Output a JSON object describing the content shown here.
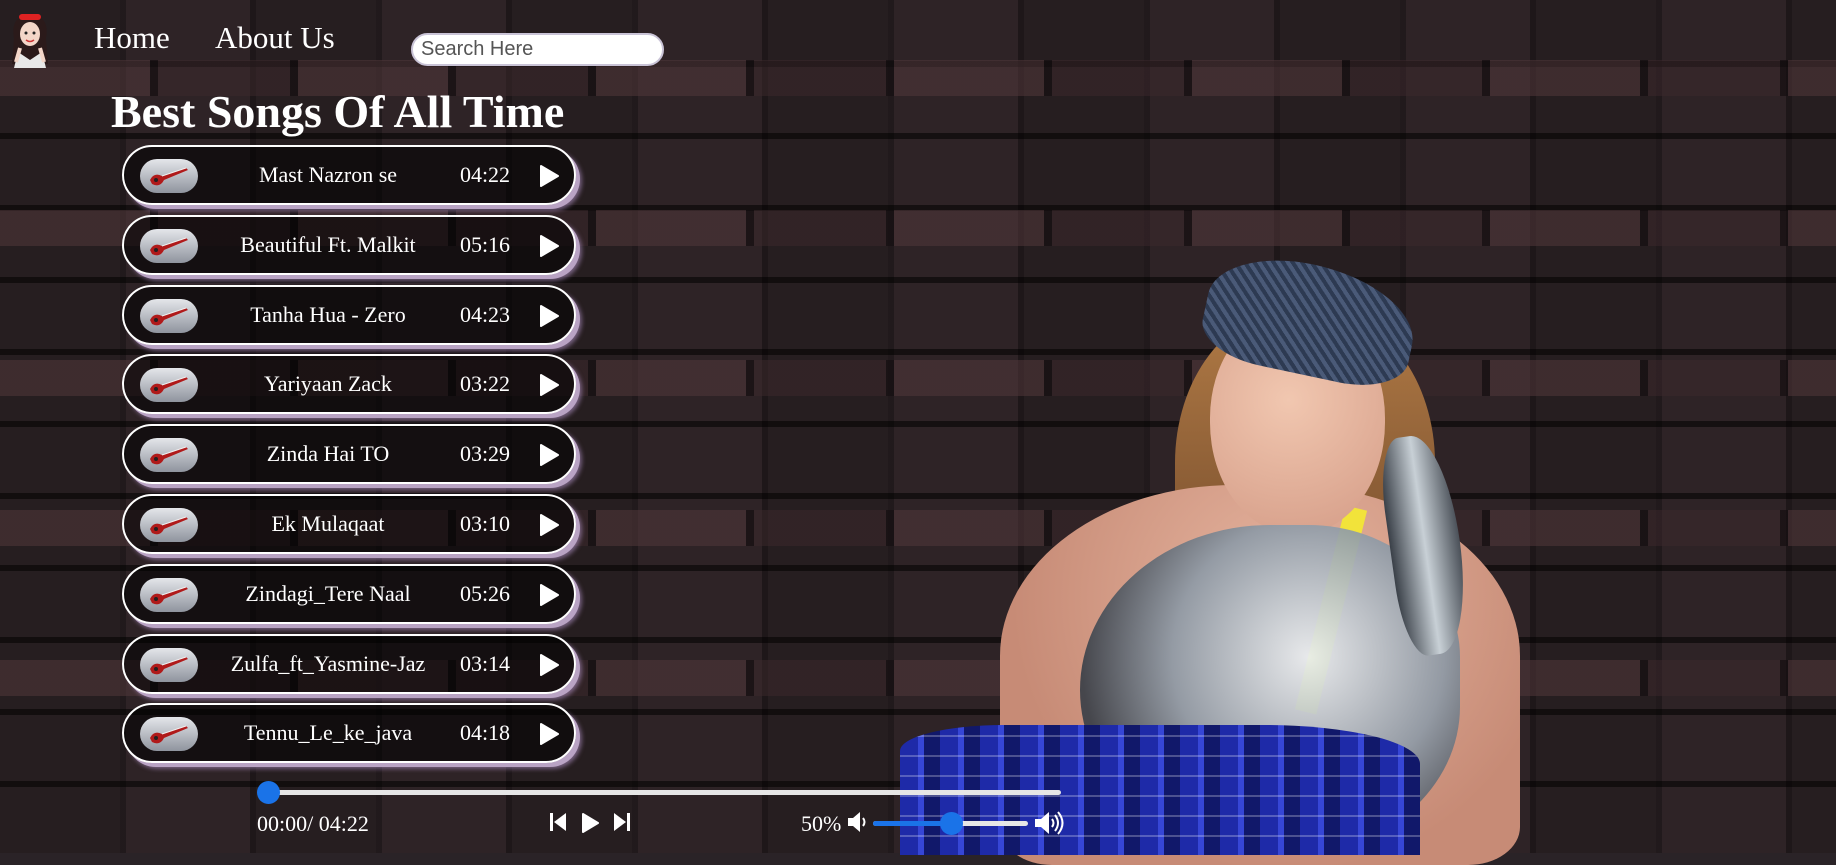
{
  "nav": {
    "home_label": "Home",
    "about_label": "About Us",
    "search_placeholder": "Search Here",
    "logo_icon": "girl-avatar-icon"
  },
  "heading": "Best Songs Of All Time",
  "songs": [
    {
      "name": "Mast Nazron se",
      "duration": "04:22"
    },
    {
      "name": "Beautiful Ft. Malkit",
      "duration": "05:16"
    },
    {
      "name": "Tanha Hua - Zero",
      "duration": "04:23"
    },
    {
      "name": "Yariyaan Zack",
      "duration": "03:22"
    },
    {
      "name": "Zinda Hai TO",
      "duration": "03:29"
    },
    {
      "name": "Ek Mulaqaat",
      "duration": "03:10"
    },
    {
      "name": "Zindagi_Tere Naal",
      "duration": "05:26"
    },
    {
      "name": "Zulfa_ft_Yasmine-Jaz",
      "duration": "03:14"
    },
    {
      "name": "Tennu_Le_ke_java",
      "duration": "04:18"
    }
  ],
  "player": {
    "time_readout": "00:00/ 04:22",
    "progress": 0,
    "volume_label": "50%",
    "volume": 0.5,
    "controls": [
      "previous-icon",
      "play-icon",
      "next-icon"
    ],
    "accent_color": "#1a73e8"
  }
}
